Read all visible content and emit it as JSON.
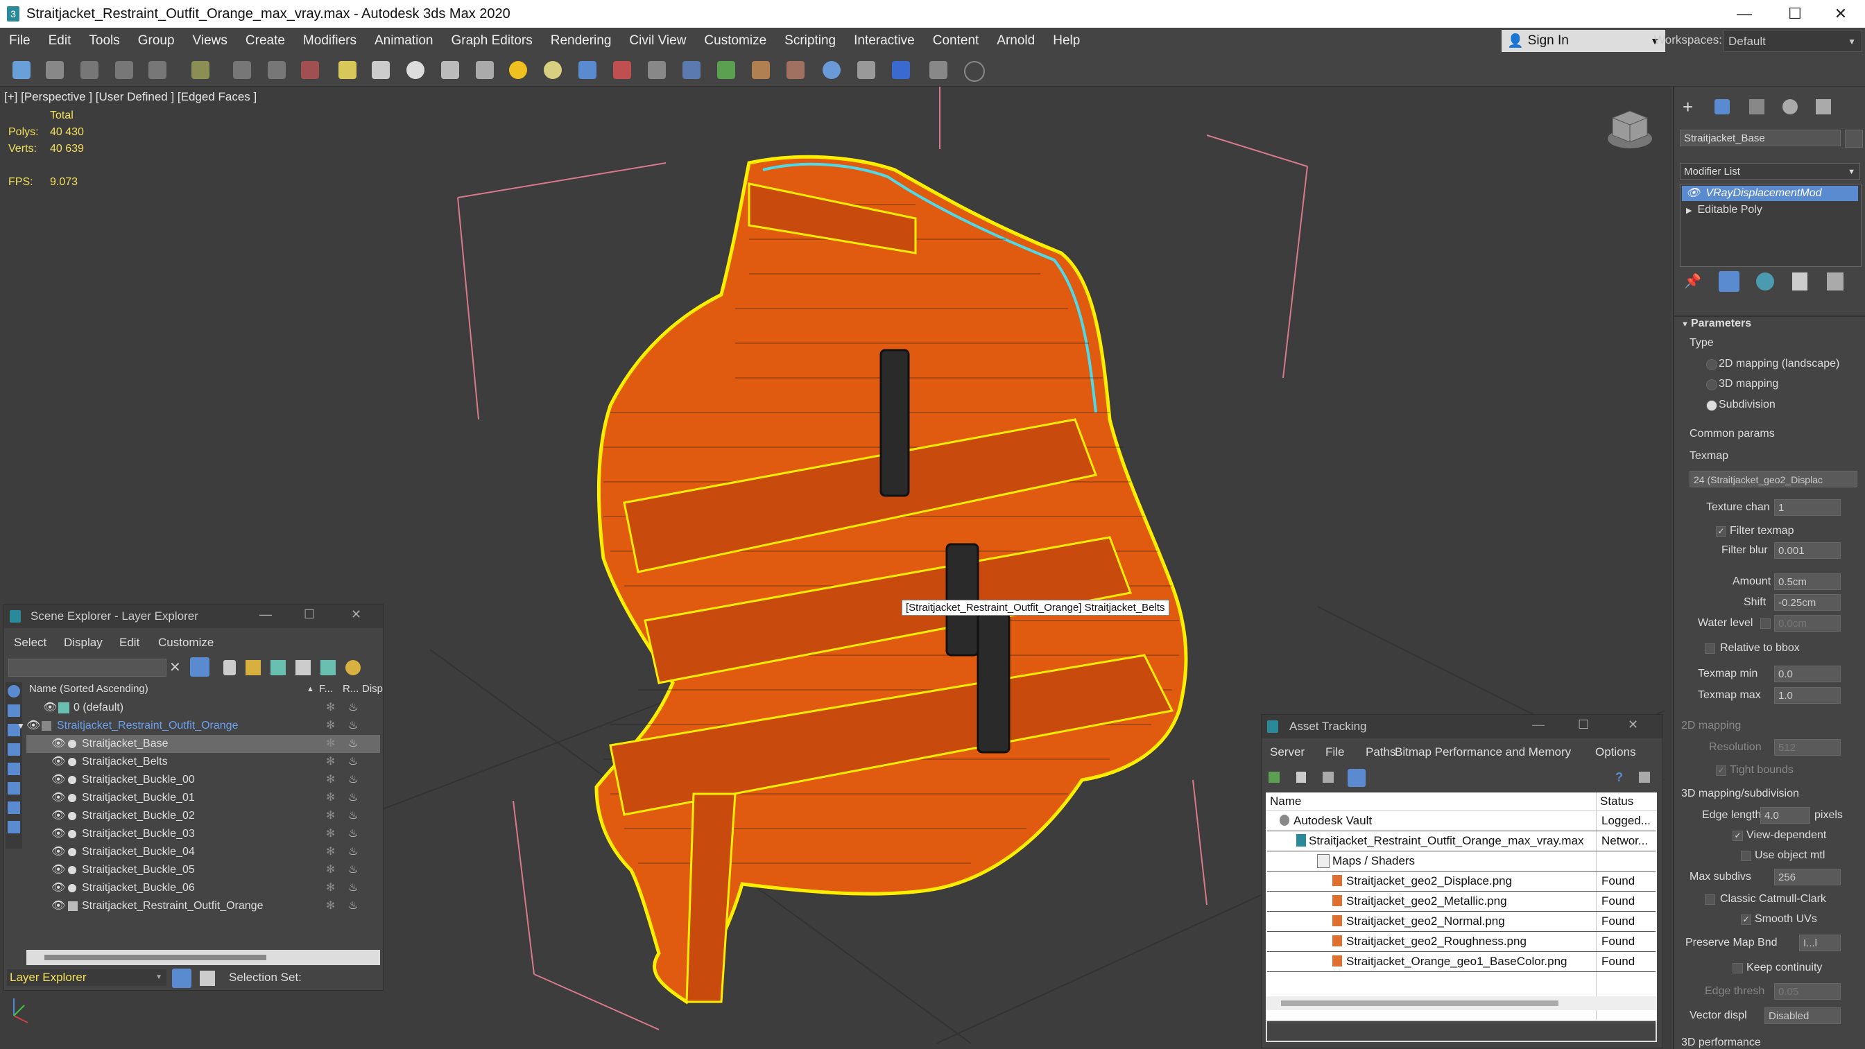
{
  "app": {
    "title": "Straitjacket_Restraint_Outfit_Orange_max_vray.max - Autodesk 3ds Max 2020",
    "app_icon": "3ds-max-icon"
  },
  "window_controls": {
    "minimize": "—",
    "maximize": "☐",
    "close": "✕"
  },
  "menu": [
    "File",
    "Edit",
    "Tools",
    "Group",
    "Views",
    "Create",
    "Modifiers",
    "Animation",
    "Graph Editors",
    "Rendering",
    "Civil View",
    "Customize",
    "Scripting",
    "Interactive",
    "Content",
    "Arnold",
    "Help"
  ],
  "signin": {
    "label": "Sign In"
  },
  "workspace": {
    "label": "Workspaces:",
    "value": "Default"
  },
  "viewport": {
    "label": "[+] [Perspective ] [User Defined ] [Edged Faces ]",
    "stats": {
      "total_label": "Total",
      "polys_label": "Polys:",
      "polys_value": "40 430",
      "verts_label": "Verts:",
      "verts_value": "40 639",
      "fps_label": "FPS:",
      "fps_value": "9.073"
    },
    "tooltip": "[Straitjacket_Restraint_Outfit_Orange] Straitjacket_Belts",
    "colors": {
      "mesh": "#e8570f",
      "selection": "#ffee00",
      "highlight": "#4fd8e8",
      "grid_box": "#d87a8c"
    }
  },
  "command_panel": {
    "object_name": "Straitjacket_Base",
    "modifier_list_label": "Modifier List",
    "stack": [
      "VRayDisplacementMod",
      "Editable Poly"
    ],
    "parameters_label": "Parameters",
    "type_label": "Type",
    "type_options": [
      "2D mapping (landscape)",
      "3D mapping",
      "Subdivision"
    ],
    "type_selected": "Subdivision",
    "common_params_label": "Common params",
    "texmap_label": "Texmap",
    "texmap_value": "24 (Straitjacket_geo2_Displac",
    "texture_chan_label": "Texture chan",
    "texture_chan_value": "1",
    "filter_texmap_label": "Filter texmap",
    "filter_blur_label": "Filter blur",
    "filter_blur_value": "0.001",
    "amount_label": "Amount",
    "amount_value": "0.5cm",
    "shift_label": "Shift",
    "shift_value": "-0.25cm",
    "water_level_label": "Water level",
    "water_level_value": "0.0cm",
    "relative_bbox_label": "Relative to bbox",
    "texmap_min_label": "Texmap min",
    "texmap_min_value": "0.0",
    "texmap_max_label": "Texmap max",
    "texmap_max_value": "1.0",
    "mapping2d_label": "2D mapping",
    "resolution_label": "Resolution",
    "resolution_value": "512",
    "tight_bounds_label": "Tight bounds",
    "mapping3d_label": "3D mapping/subdivision",
    "edge_length_label": "Edge length",
    "edge_length_value": "4.0",
    "pixels_label": "pixels",
    "view_dependent_label": "View-dependent",
    "use_object_mtl_label": "Use object mtl",
    "max_subdivs_label": "Max subdivs",
    "max_subdivs_value": "256",
    "classic_catmull_label": "Classic Catmull-Clark",
    "smooth_uvs_label": "Smooth UVs",
    "preserve_map_label": "Preserve Map Bnd",
    "preserve_map_value": "I...l",
    "keep_continuity_label": "Keep continuity",
    "edge_thresh_label": "Edge thresh",
    "edge_thresh_value": "0.05",
    "vector_displ_label": "Vector displ",
    "vector_displ_value": "Disabled",
    "perf_label": "3D performance"
  },
  "scene_explorer": {
    "title": "Scene Explorer - Layer Explorer",
    "menu": [
      "Select",
      "Display",
      "Edit",
      "Customize"
    ],
    "columns": {
      "name": "Name (Sorted Ascending)",
      "frozen": "F...",
      "render": "R...",
      "display": "Disp"
    },
    "rows": [
      {
        "name": "0 (default)",
        "level": 0
      },
      {
        "name": "Straitjacket_Restraint_Outfit_Orange",
        "level": 0
      },
      {
        "name": "Straitjacket_Base",
        "level": 1
      },
      {
        "name": "Straitjacket_Belts",
        "level": 1
      },
      {
        "name": "Straitjacket_Buckle_00",
        "level": 1
      },
      {
        "name": "Straitjacket_Buckle_01",
        "level": 1
      },
      {
        "name": "Straitjacket_Buckle_02",
        "level": 1
      },
      {
        "name": "Straitjacket_Buckle_03",
        "level": 1
      },
      {
        "name": "Straitjacket_Buckle_04",
        "level": 1
      },
      {
        "name": "Straitjacket_Buckle_05",
        "level": 1
      },
      {
        "name": "Straitjacket_Buckle_06",
        "level": 1
      },
      {
        "name": "Straitjacket_Restraint_Outfit_Orange",
        "level": 1
      }
    ],
    "footer": {
      "explorer_value": "Layer Explorer",
      "selection_set_label": "Selection Set:"
    }
  },
  "asset_tracking": {
    "title": "Asset Tracking",
    "menu": [
      "Server",
      "File",
      "Paths",
      "Bitmap Performance and Memory",
      "Options"
    ],
    "columns": {
      "name": "Name",
      "status": "Status"
    },
    "rows": [
      {
        "name": "Autodesk Vault",
        "status": "Logged...",
        "level": 0
      },
      {
        "name": "Straitjacket_Restraint_Outfit_Orange_max_vray.max",
        "status": "Networ...",
        "level": 1
      },
      {
        "name": "Maps / Shaders",
        "status": "",
        "level": 2
      },
      {
        "name": "Straitjacket_geo2_Displace.png",
        "status": "Found",
        "level": 3
      },
      {
        "name": "Straitjacket_geo2_Metallic.png",
        "status": "Found",
        "level": 3
      },
      {
        "name": "Straitjacket_geo2_Normal.png",
        "status": "Found",
        "level": 3
      },
      {
        "name": "Straitjacket_geo2_Roughness.png",
        "status": "Found",
        "level": 3
      },
      {
        "name": "Straitjacket_Orange_geo1_BaseColor.png",
        "status": "Found",
        "level": 3
      }
    ]
  }
}
